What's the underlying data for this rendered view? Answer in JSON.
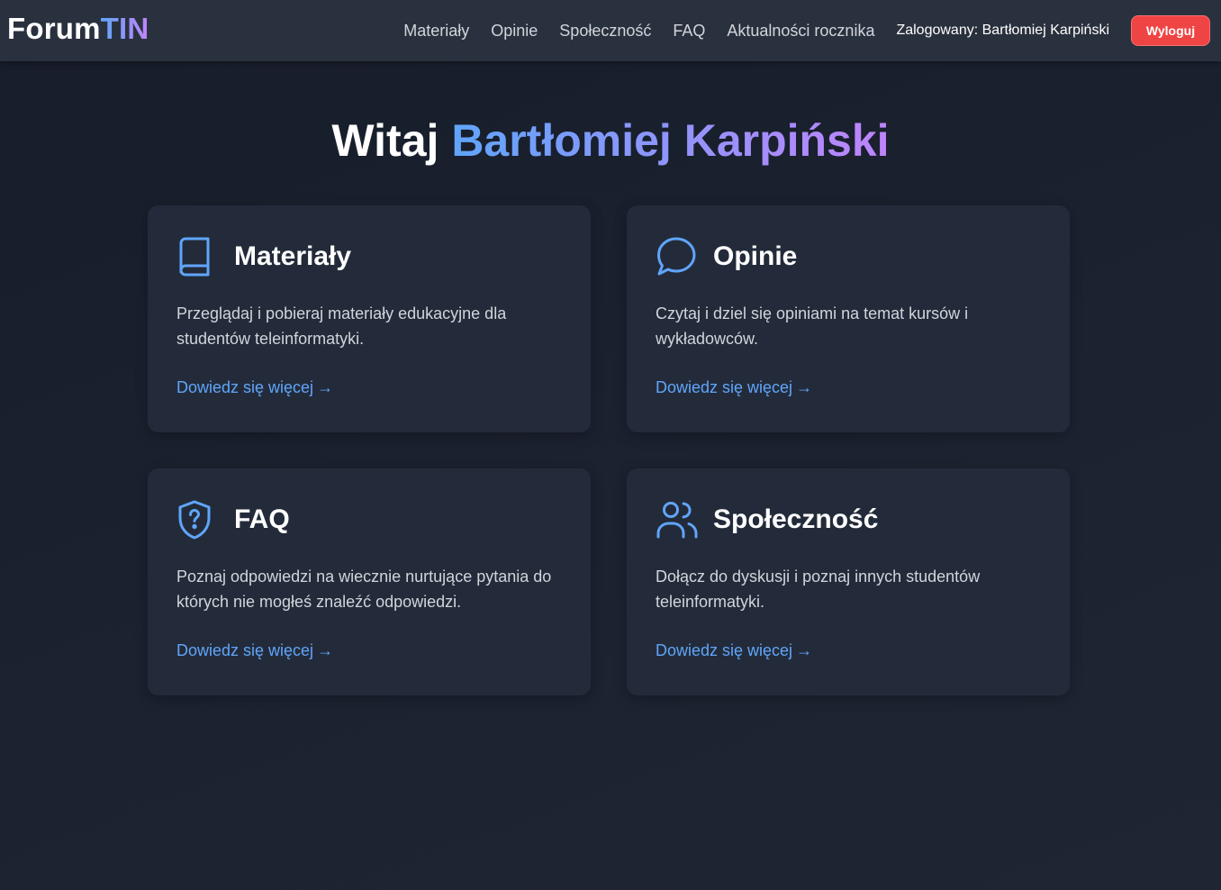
{
  "header": {
    "logo_part1": "Forum",
    "logo_part2": "TIN",
    "nav": [
      {
        "label": "Materiały"
      },
      {
        "label": "Opinie"
      },
      {
        "label": "Społeczność"
      },
      {
        "label": "FAQ"
      },
      {
        "label": "Aktualności rocznika"
      }
    ],
    "logged_in": "Zalogowany: Bartłomiej Karpiński",
    "logout_label": "Wyloguj"
  },
  "welcome": {
    "greeting": "Witaj",
    "name": "Bartłomiej Karpiński"
  },
  "cards": [
    {
      "icon": "book-icon",
      "title": "Materiały",
      "description": "Przeglądaj i pobieraj materiały edukacyjne dla studentów teleinformatyki.",
      "link": "Dowiedz się więcej",
      "arrow": "→"
    },
    {
      "icon": "chat-bubble-icon",
      "title": "Opinie",
      "description": "Czytaj i dziel się opiniami na temat kursów i wykładowców.",
      "link": "Dowiedz się więcej",
      "arrow": "→"
    },
    {
      "icon": "shield-question-icon",
      "title": "FAQ",
      "description": "Poznaj odpowiedzi na wiecznie nurtujące pytania do których nie mogłeś znaleźć odpowiedzi.",
      "link": "Dowiedz się więcej",
      "arrow": "→"
    },
    {
      "icon": "users-icon",
      "title": "Społeczność",
      "description": "Dołącz do dyskusji i poznaj innych studentów teleinformatyki.",
      "link": "Dowiedz się więcej",
      "arrow": "→"
    }
  ],
  "colors": {
    "accent": "#60a5fa",
    "accent_secondary": "#c084fc",
    "logout": "#ef4444",
    "background": "#1b2230",
    "card": "#232b3a",
    "navbar": "#2a313e"
  }
}
